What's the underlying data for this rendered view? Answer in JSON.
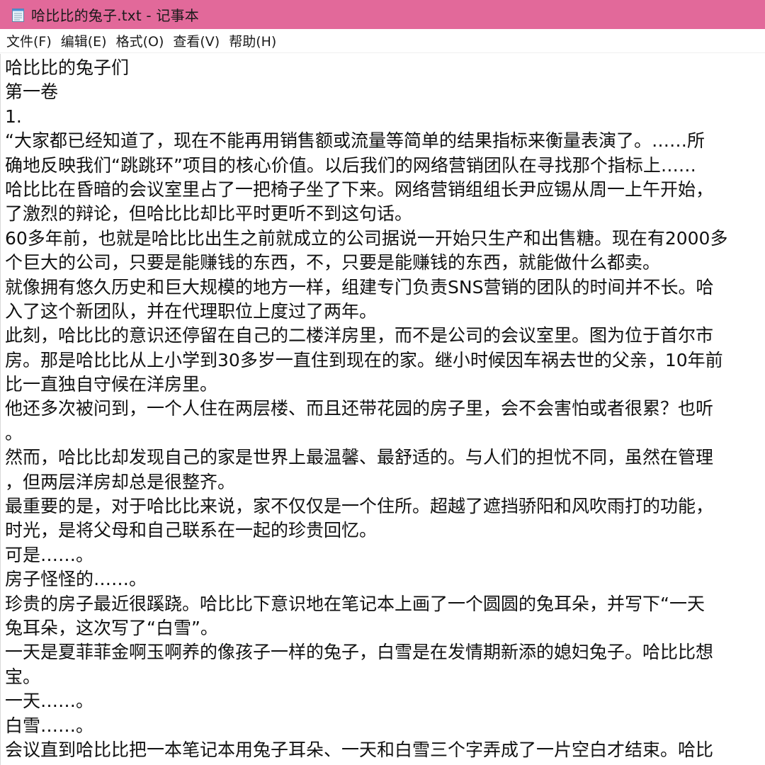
{
  "window": {
    "title": "哈比比的兔子.txt - 记事本",
    "icon": "notepad-icon",
    "titlebar_color": "#e2699a"
  },
  "menu": [
    {
      "label": "文件(F)"
    },
    {
      "label": "编辑(E)"
    },
    {
      "label": "格式(O)"
    },
    {
      "label": "查看(V)"
    },
    {
      "label": "帮助(H)"
    }
  ],
  "document": {
    "lines": [
      "哈比比的兔子们",
      "第一卷",
      "1.",
      "“大家都已经知道了，现在不能再用销售额或流量等简单的结果指标来衡量表演了。……所",
      "确地反映我们“跳跳环”项目的核心价值。以后我们的网络营销团队在寻找那个指标上……",
      "哈比比在昏暗的会议室里占了一把椅子坐了下来。网络营销组组长尹应锡从周一上午开始，",
      "了激烈的辩论，但哈比比却比平时更听不到这句话。",
      "60多年前，也就是哈比比出生之前就成立的公司据说一开始只生产和出售糖。现在有2000多",
      "个巨大的公司，只要是能赚钱的东西，不，只要是能赚钱的东西，就能做什么都卖。",
      "就像拥有悠久历史和巨大规模的地方一样，组建专门负责SNS营销的团队的时间并不长。哈",
      "入了这个新团队，并在代理职位上度过了两年。",
      "此刻，哈比比的意识还停留在自己的二楼洋房里，而不是公司的会议室里。图为位于首尔市",
      "房。那是哈比比从上小学到30多岁一直住到现在的家。继小时候因车祸去世的父亲，10年前",
      "比一直独自守候在洋房里。",
      "他还多次被问到，一个人住在两层楼、而且还带花园的房子里，会不会害怕或者很累？也听",
      "。",
      "然而，哈比比却发现自己的家是世界上最温馨、最舒适的。与人们的担忧不同，虽然在管理",
      "，但两层洋房却总是很整齐。",
      "最重要的是，对于哈比比来说，家不仅仅是一个住所。超越了遮挡骄阳和风吹雨打的功能，",
      "时光，是将父母和自己联系在一起的珍贵回忆。",
      "可是……。",
      "房子怪怪的……。",
      "珍贵的房子最近很蹊跷。哈比比下意识地在笔记本上画了一个圆圆的兔耳朵，并写下“一天",
      "兔耳朵，这次写了“白雪”。",
      "一天是夏菲菲金啊玉啊养的像孩子一样的兔子，白雪是在发情期新添的媳妇兔子。哈比比想",
      "宝。",
      "一天……。",
      "白雪……。",
      "会议直到哈比比把一本笔记本用兔子耳朵、一天和白雪三个字弄成了一片空白才结束。哈比"
    ]
  }
}
